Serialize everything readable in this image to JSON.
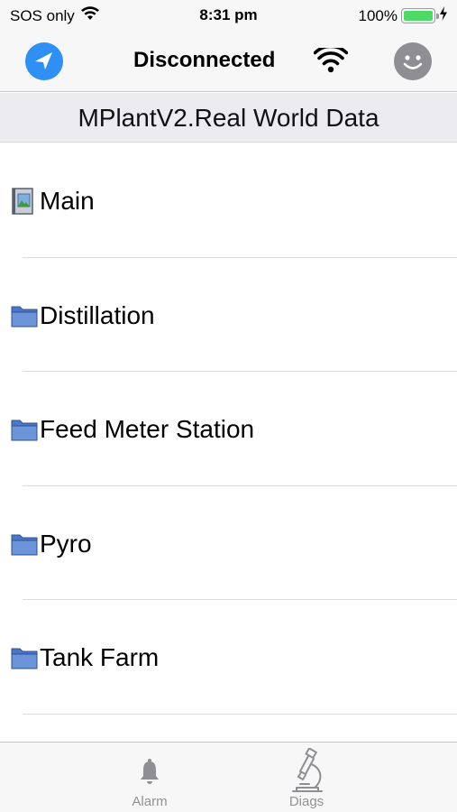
{
  "status_bar": {
    "carrier": "SOS only",
    "time": "8:31 pm",
    "battery_percent": "100%",
    "battery_level": 1.0,
    "battery_color": "#4cd964"
  },
  "nav_bar": {
    "title": "Disconnected",
    "back_icon": "location-arrow-icon",
    "connection_icon": "wifi-icon",
    "avatar_icon": "smiley-face-icon",
    "accent_color": "#2e8ff5"
  },
  "section": {
    "title": "MPlantV2.Real World Data"
  },
  "list": {
    "items": [
      {
        "label": "Main",
        "icon": "display-page-icon"
      },
      {
        "label": "Distillation",
        "icon": "folder-icon"
      },
      {
        "label": "Feed Meter Station",
        "icon": "folder-icon"
      },
      {
        "label": "Pyro",
        "icon": "folder-icon"
      },
      {
        "label": "Tank Farm",
        "icon": "folder-icon"
      }
    ]
  },
  "tab_bar": {
    "tabs": [
      {
        "label": "Alarm",
        "icon": "bell-icon"
      },
      {
        "label": "Diags",
        "icon": "microscope-icon"
      }
    ]
  }
}
